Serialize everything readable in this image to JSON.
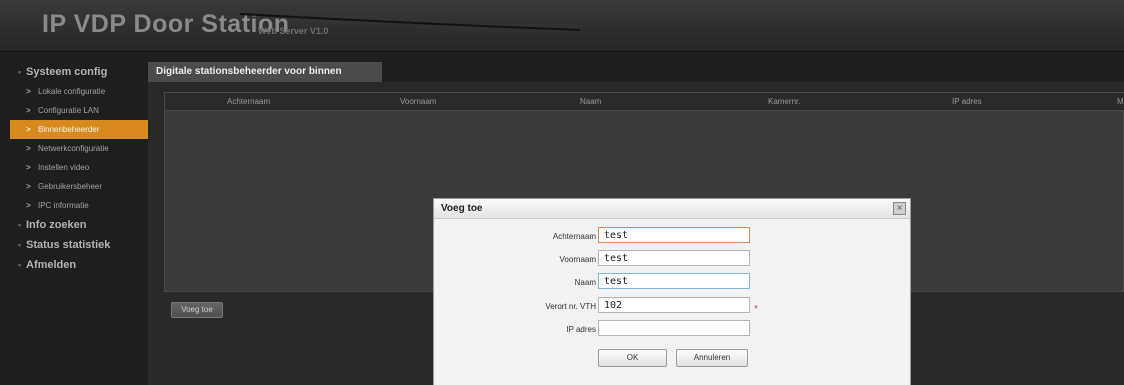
{
  "header": {
    "title": "IP VDP Door Station",
    "subtitle": "Web Server V1.0"
  },
  "sidebar": {
    "group_system": "Systeem config",
    "items": [
      {
        "label": "Lokale configuratie"
      },
      {
        "label": "Configuratie LAN"
      },
      {
        "label": "Binnenbeheerder"
      },
      {
        "label": "Netwerkconfiguratie"
      },
      {
        "label": "Instellen video"
      },
      {
        "label": "Gebruikersbeheer"
      },
      {
        "label": "IPC informatie"
      }
    ],
    "groups_other": [
      "Info zoeken",
      "Status statistiek",
      "Afmelden"
    ],
    "active_index": 2
  },
  "main": {
    "tab_label": "Digitale stationsbeheerder voor binnen",
    "columns": [
      "Achternaam",
      "Voornaam",
      "Naam",
      "Kamernr.",
      "IP adres",
      "M"
    ],
    "add_button": "Voeg toe"
  },
  "dialog": {
    "title": "Voeg toe",
    "fields": [
      {
        "label": "Achternaam",
        "value": "test"
      },
      {
        "label": "Voornaam",
        "value": "test"
      },
      {
        "label": "Naam",
        "value": "test"
      },
      {
        "label": "Verort nr. VTH",
        "value": "102"
      },
      {
        "label": "IP adres",
        "value": ""
      }
    ],
    "required_marker": "*",
    "ok_label": "OK",
    "cancel_label": "Annuleren",
    "close_glyph": "×"
  },
  "colors": {
    "accent": "#d88a1e",
    "background": "#1e1e1e"
  }
}
